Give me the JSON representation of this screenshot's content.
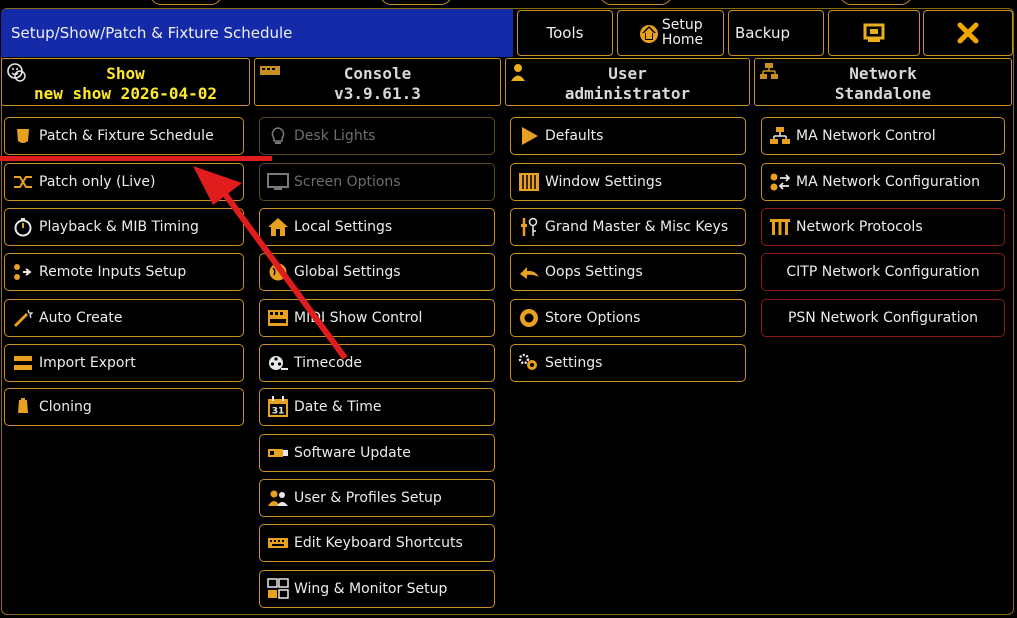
{
  "titlebar": {
    "path": "Setup/Show/Patch & Fixture Schedule"
  },
  "toolbar": {
    "tools": "Tools",
    "setup_home_line1": "Setup",
    "setup_home_line2": "Home",
    "backup": "Backup"
  },
  "headers": {
    "show": {
      "label": "Show",
      "value": "new show 2026-04-02"
    },
    "console": {
      "label": "Console",
      "value": "v3.9.61.3"
    },
    "user": {
      "label": "User",
      "value": "administrator"
    },
    "network": {
      "label": "Network",
      "value": "Standalone"
    }
  },
  "show_items": [
    "Patch & Fixture Schedule",
    "Patch only (Live)",
    "Playback & MIB Timing",
    "Remote Inputs Setup",
    "Auto Create",
    "Import Export",
    "Cloning"
  ],
  "console_items": [
    "Desk Lights",
    "Screen Options",
    "Local Settings",
    "Global Settings",
    "MIDI Show Control",
    "Timecode",
    "Date & Time",
    "Software Update",
    "User & Profiles Setup",
    "Edit Keyboard Shortcuts",
    "Wing & Monitor Setup"
  ],
  "user_items": [
    "Defaults",
    "Window Settings",
    "Grand Master & Misc Keys",
    "Oops Settings",
    "Store Options",
    "Settings"
  ],
  "network_items": [
    "MA Network Control",
    "MA Network Configuration",
    "Network Protocols",
    "CITP Network Configuration",
    "PSN Network Configuration"
  ],
  "calendar_icon_text": "31",
  "colors": {
    "title_blue": "#142aa8",
    "accent_gold": "#c89020",
    "show_yellow": "#ffea2a",
    "annotation_red": "#e01c1c"
  }
}
